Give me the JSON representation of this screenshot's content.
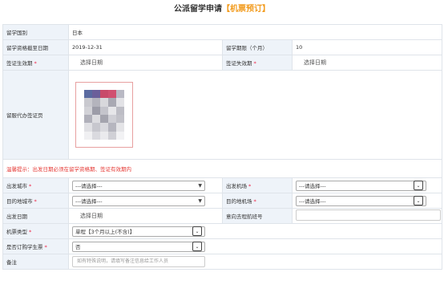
{
  "page": {
    "title_main": "公派留学申请",
    "title_sub": "【机票预订】"
  },
  "form": {
    "country_label": "留学国别",
    "country_value": "日本",
    "deadline_label": "留学资格截至日期",
    "deadline_value": "2019-12-31",
    "period_label": "留学期限（个月）",
    "period_value": "10",
    "visa_start_label": "签证生效期",
    "visa_start_value": "选择日期",
    "visa_end_label": "签证失效期",
    "visa_end_value": "选择日期",
    "visa_page_label": "留服代办签证页",
    "warning": "温馨提示：出发日期必须在留学资格期、签证有效期内",
    "dep_city_label": "出发城市",
    "dep_city_value": "---请选择---",
    "dep_airport_label": "出发机场",
    "dep_airport_value": "---请选择---",
    "dest_city_label": "目的地城市",
    "dest_city_value": "---请选择---",
    "dest_airport_label": "目的地机场",
    "dest_airport_value": "---请选择---",
    "dep_date_label": "出发日期",
    "dep_date_value": "选择日期",
    "return_flight_label": "意向去程航班号",
    "ticket_type_label": "机票类型",
    "ticket_type_value": "单程【3个月以上(不含)】",
    "student_ticket_label": "是否订购学生票",
    "student_ticket_value": "否",
    "remark_label": "备注",
    "remark_placeholder": "如有特殊说明，请填写备注信息给工作人员"
  },
  "required_mark": "*"
}
